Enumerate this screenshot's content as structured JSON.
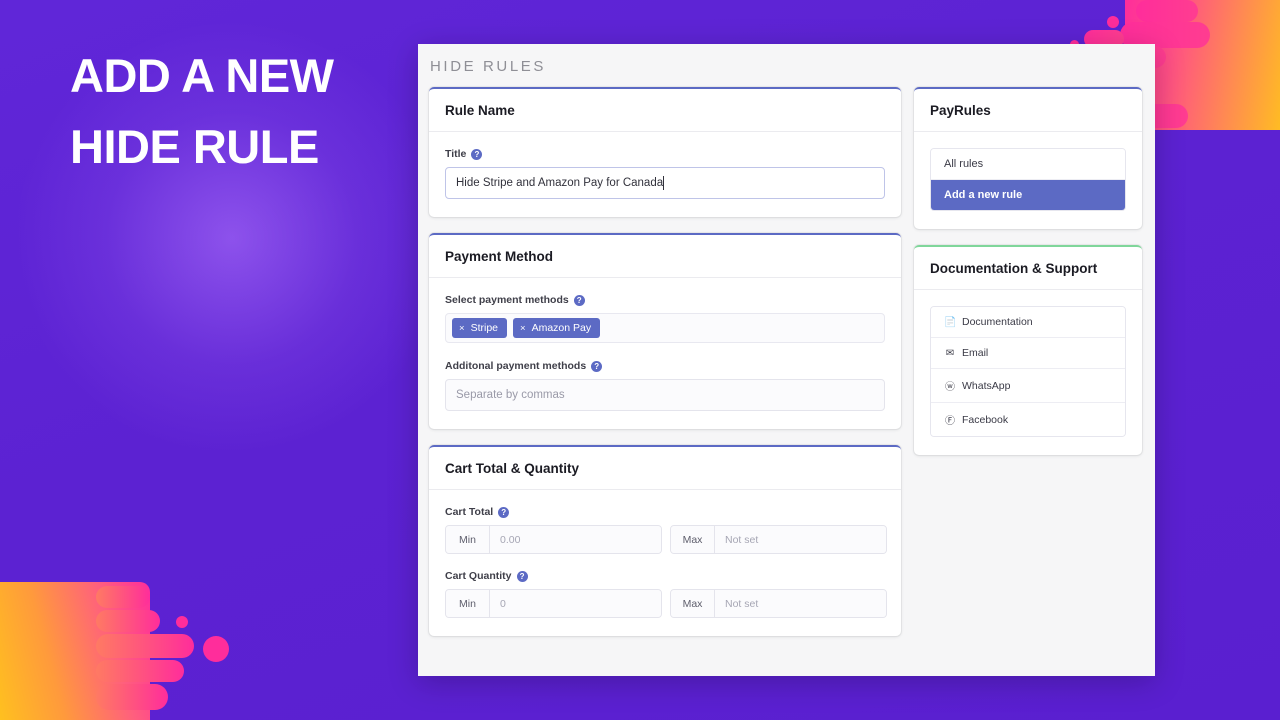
{
  "promo": {
    "headline_line1": "ADD A NEW",
    "headline_line2": "HIDE RULE"
  },
  "app": {
    "title": "HIDE RULES"
  },
  "colors": {
    "background_purple": "#5b21cc",
    "accent_indigo": "#5c6ac4",
    "accent_green": "#7fd69a",
    "blob_pink": "#ff2d9b",
    "blob_orange": "#ffc01f"
  },
  "rule_name_card": {
    "heading": "Rule Name",
    "title_label": "Title",
    "title_help": "?",
    "title_value": "Hide Stripe and Amazon Pay for Canada"
  },
  "payment_method_card": {
    "heading": "Payment Method",
    "select_label": "Select payment methods",
    "select_help": "?",
    "tags": [
      {
        "remove": "×",
        "label": "Stripe"
      },
      {
        "remove": "×",
        "label": "Amazon Pay"
      }
    ],
    "additional_label": "Additonal payment methods",
    "additional_help": "?",
    "additional_placeholder": "Separate by commas"
  },
  "cart_card": {
    "heading": "Cart Total & Quantity",
    "cart_total_label": "Cart Total",
    "cart_total_help": "?",
    "cart_total_min_addon": "Min",
    "cart_total_min_value": "0.00",
    "cart_total_max_addon": "Max",
    "cart_total_max_value": "Not set",
    "cart_qty_label": "Cart Quantity",
    "cart_qty_help": "?",
    "cart_qty_min_addon": "Min",
    "cart_qty_min_value": "0",
    "cart_qty_max_addon": "Max",
    "cart_qty_max_value": "Not set"
  },
  "payrules_card": {
    "heading": "PayRules",
    "items": [
      {
        "label": "All rules",
        "active": false
      },
      {
        "label": "Add a new rule",
        "active": true
      }
    ]
  },
  "support_card": {
    "heading": "Documentation & Support",
    "items": [
      {
        "icon": "📄",
        "icon_name": "document-icon",
        "label": "Documentation"
      },
      {
        "icon": "✉",
        "icon_name": "envelope-icon",
        "label": "Email"
      },
      {
        "icon": "ⓦ",
        "icon_name": "whatsapp-icon",
        "label": "WhatsApp"
      },
      {
        "icon": "Ⓕ",
        "icon_name": "facebook-icon",
        "label": "Facebook"
      }
    ]
  }
}
